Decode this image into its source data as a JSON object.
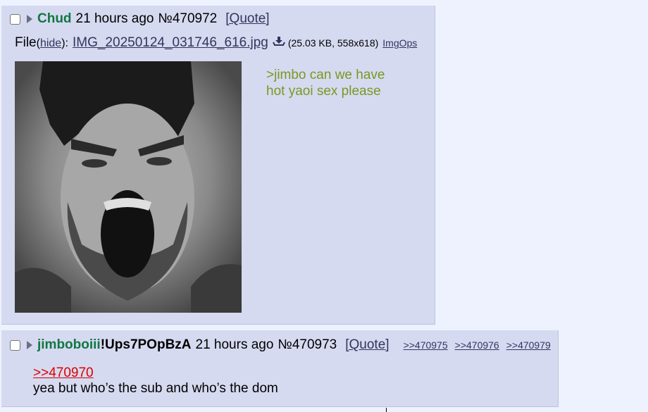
{
  "posts": [
    {
      "name": "Chud",
      "time": "21 hours ago",
      "number": "№470972",
      "quote_label": "[Quote]",
      "file": {
        "label": "File",
        "hide_open": " (",
        "hide_label": "hide",
        "hide_close": "):",
        "filename": "IMG_20250124_031746_616.jpg",
        "meta": "(25.03 KB, 558x618)",
        "imgops": "ImgOps"
      },
      "greentext": ">jimbo can we have hot yaoi sex please"
    },
    {
      "name": "jimboboiii",
      "tripcode": "!Ups7POpBzA",
      "time": "21 hours ago",
      "number": "№470973",
      "quote_label": "[Quote]",
      "backlinks": [
        ">>470975",
        ">>470976",
        ">>470979"
      ],
      "reply_link": ">>470970",
      "body": "yea but who’s the sub and who’s the dom"
    }
  ],
  "colors": {
    "background": "#eef2ff",
    "post_bg": "#d6daf0",
    "name": "#117743",
    "greentext": "#789922",
    "link": "#34345c",
    "reply_link": "#dd0000"
  }
}
